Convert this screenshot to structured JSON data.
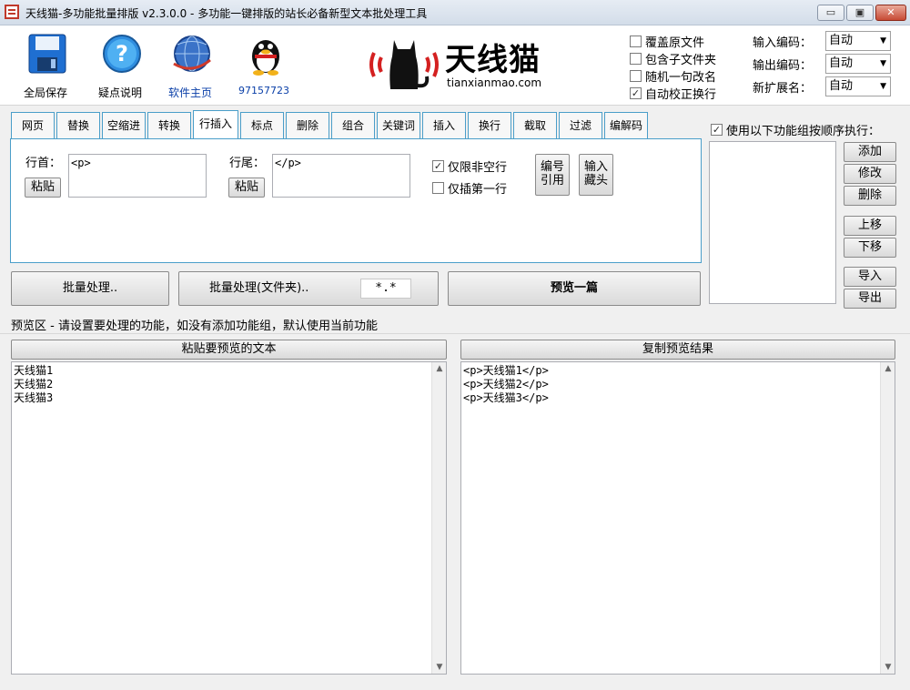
{
  "title": "天线猫-多功能批量排版 v2.3.0.0 - 多功能一键排版的站长必备新型文本批处理工具",
  "window_controls": {
    "minimize": "▭",
    "restore": "▣",
    "close": "✕"
  },
  "toolbar": [
    {
      "label": "全局保存",
      "icon": "floppy-icon"
    },
    {
      "label": "疑点说明",
      "icon": "question-icon"
    },
    {
      "label": "软件主页",
      "icon": "globe-icon"
    },
    {
      "label": "97157723",
      "icon": "qq-penguin-icon"
    }
  ],
  "logo": {
    "name": "天线猫",
    "domain": "tianxianmao.com"
  },
  "options": [
    {
      "label": "覆盖原文件",
      "checked": false
    },
    {
      "label": "包含子文件夹",
      "checked": false
    },
    {
      "label": "随机一句改名",
      "checked": false
    },
    {
      "label": "自动校正换行",
      "checked": true
    }
  ],
  "encoding": {
    "input_label": "输入编码：",
    "input_value": "自动",
    "output_label": "输出编码：",
    "output_value": "自动",
    "ext_label": "新扩展名：",
    "ext_value": "自动"
  },
  "tabs": [
    "网页",
    "替换",
    "空缩进",
    "转换",
    "行插入",
    "标点",
    "删除",
    "组合",
    "关键词",
    "插入",
    "换行",
    "截取",
    "过滤",
    "编解码"
  ],
  "active_tab": "行插入",
  "panel": {
    "head_label": "行首：",
    "head_value": "<p>",
    "head_paste": "粘贴",
    "tail_label": "行尾：",
    "tail_value": "</p>",
    "tail_paste": "粘贴",
    "only_nonempty": "仅限非空行",
    "only_nonempty_checked": true,
    "only_first": "仅插第一行",
    "only_first_checked": false,
    "number_btn": "编号\n引用",
    "input_btn": "输入\n藏头"
  },
  "actions": {
    "batch": "批量处理..",
    "batch_folder": "批量处理(文件夹)..",
    "filter_value": "*.*",
    "preview_one": "预览一篇"
  },
  "group": {
    "use_label": "使用以下功能组按顺序执行：",
    "use_checked": true,
    "buttons": [
      "添加",
      "修改",
      "删除",
      "上移",
      "下移",
      "导入",
      "导出"
    ]
  },
  "preview": {
    "hint": "预览区 - 请设置要处理的功能，如没有添加功能组，默认使用当前功能",
    "paste_btn": "粘贴要预览的文本",
    "copy_btn": "复制预览结果",
    "input_text": "天线猫1\n天线猫2\n天线猫3",
    "output_text": "<p>天线猫1</p>\n<p>天线猫2</p>\n<p>天线猫3</p>"
  },
  "colors": {
    "accent": "#4a9ec9",
    "logo_red": "#d42020",
    "close": "#c74a34"
  }
}
